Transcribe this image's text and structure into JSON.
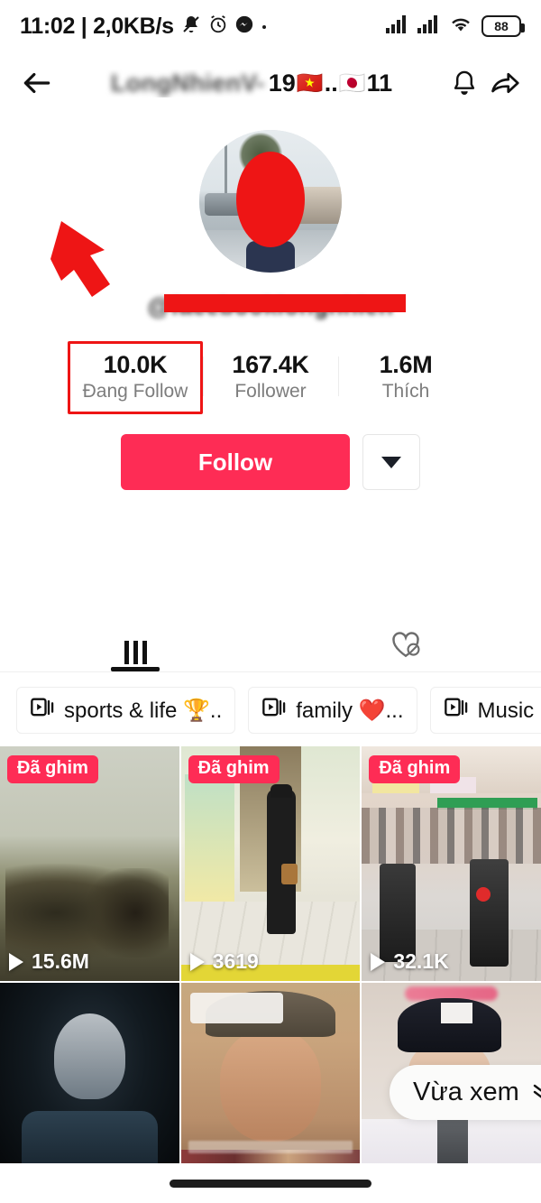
{
  "status_bar": {
    "time": "11:02",
    "separator": "|",
    "network_speed": "2,0KB/s",
    "icons": [
      "bell-muted-icon",
      "alarm-icon",
      "messenger-icon",
      "dot-icon"
    ],
    "right_icons": [
      "signal-icon",
      "signal-icon-2",
      "wifi-icon"
    ],
    "battery_level": "88"
  },
  "header": {
    "back_icon": "back-arrow-icon",
    "username_blurred": "LongNhienV-",
    "badge_left_number": "19",
    "badge_flag_vn": "🇻🇳",
    "badge_dots": "..",
    "badge_flag_jp": "🇯🇵",
    "badge_right_number": "11",
    "bell_icon": "bell-icon",
    "share_icon": "share-icon"
  },
  "profile": {
    "avatar_name": "profile-avatar",
    "handle": "@facebooklongnhien",
    "handle_redacted": true
  },
  "stats": [
    {
      "value": "10.0K",
      "label": "Đang Follow",
      "highlighted": true
    },
    {
      "value": "167.4K",
      "label": "Follower",
      "highlighted": false
    },
    {
      "value": "1.6M",
      "label": "Thích",
      "highlighted": false
    }
  ],
  "actions": {
    "follow_label": "Follow",
    "more_icon": "chevron-down-icon"
  },
  "tabs": [
    {
      "icon": "grid-icon",
      "active": true
    },
    {
      "icon": "heart-private-icon",
      "active": false
    }
  ],
  "playlists": [
    {
      "icon": "playlist-icon",
      "label": "sports & life 🏆.."
    },
    {
      "icon": "playlist-icon",
      "label": "family ❤️..."
    },
    {
      "icon": "playlist-icon",
      "label": "Music 🎼.."
    }
  ],
  "videos": [
    {
      "pin_label": "Đã ghim",
      "views": "15.6M",
      "thumb": "t1",
      "pinned": true
    },
    {
      "pin_label": "Đã ghim",
      "views": "3619",
      "thumb": "t2",
      "pinned": true
    },
    {
      "pin_label": "Đã ghim",
      "views": "32.1K",
      "thumb": "t3",
      "pinned": true
    },
    {
      "pin_label": "",
      "views": "",
      "thumb": "t4",
      "pinned": false
    },
    {
      "pin_label": "",
      "views": "",
      "thumb": "t5",
      "pinned": false
    },
    {
      "pin_label": "",
      "views": "",
      "thumb": "t6",
      "pinned": false
    }
  ],
  "overlay": {
    "recently_viewed_label": "Vừa xem",
    "chevron_icon": "double-chevron-down-icon"
  },
  "annotations": {
    "arrow_color": "#ee1515",
    "highlight_box_color": "#ee1515",
    "redaction_color": "#ee1515"
  },
  "colors": {
    "tiktok_red": "#fe2c55",
    "text_primary": "#121212",
    "text_secondary": "#7d7d7d"
  }
}
